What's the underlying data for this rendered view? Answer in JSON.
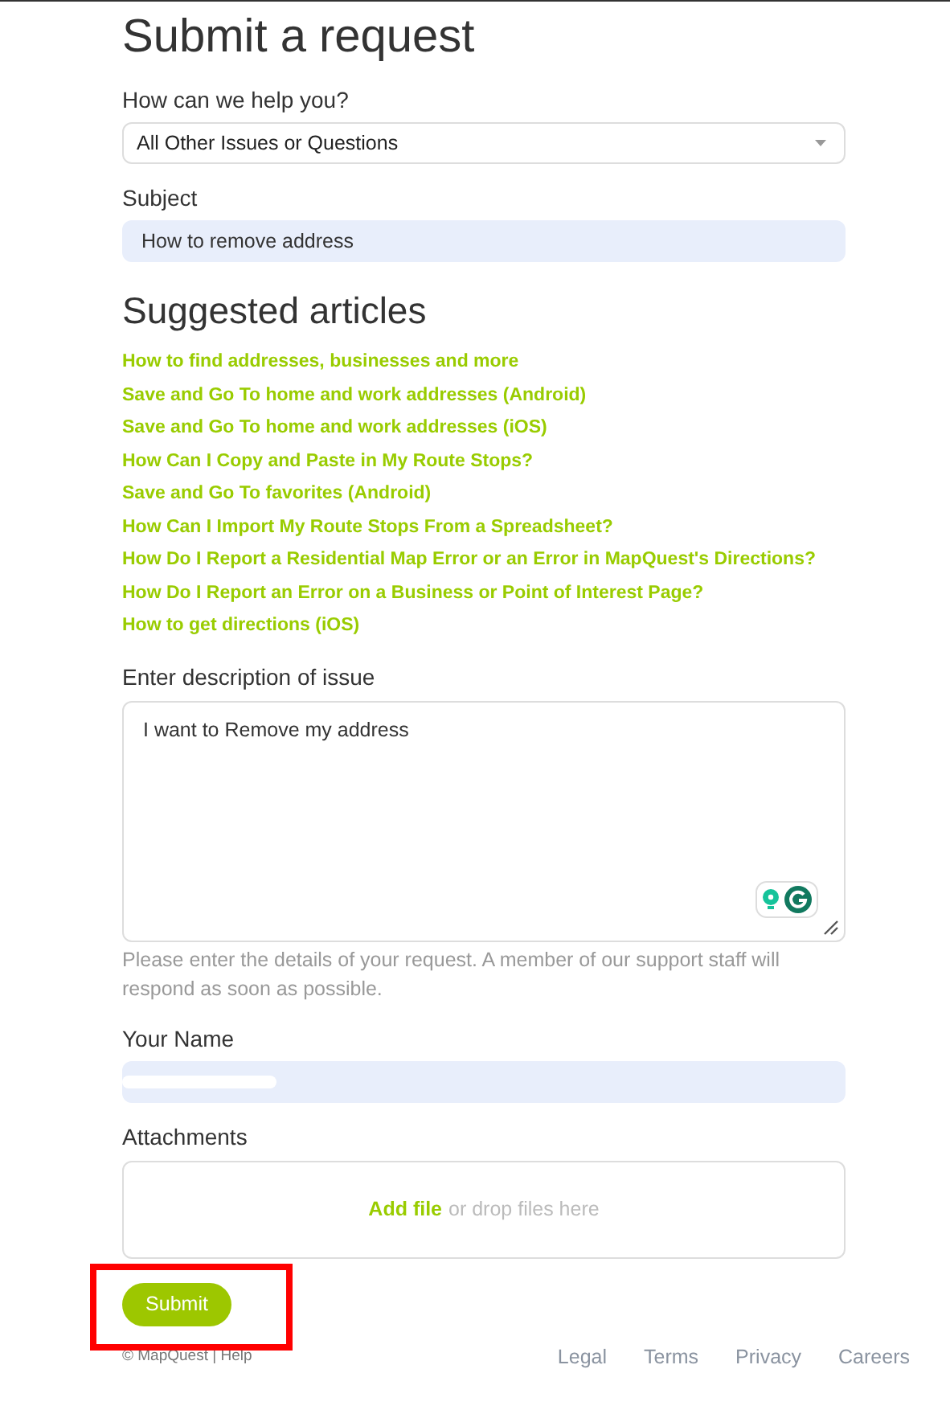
{
  "title": "Submit a request",
  "help_select": {
    "label": "How can we help you?",
    "value": "All Other Issues or Questions"
  },
  "subject": {
    "label": "Subject",
    "value": "How to remove address"
  },
  "suggested": {
    "heading": "Suggested articles",
    "articles": [
      "How to find addresses, businesses and more",
      "Save and Go To home and work addresses (Android)",
      "Save and Go To home and work addresses (iOS)",
      "How Can I Copy and Paste in My Route Stops?",
      "Save and Go To favorites (Android)",
      "How Can I Import My Route Stops From a Spreadsheet?",
      "How Do I Report a Residential Map Error or an Error in MapQuest's Directions?",
      "How Do I Report an Error on a Business or Point of Interest Page?",
      "How to get directions (iOS)"
    ]
  },
  "description": {
    "label": "Enter description of issue",
    "value": "I want to Remove my address",
    "hint": "Please enter the details of your request. A member of our support staff will respond as soon as possible."
  },
  "name": {
    "label": "Your Name"
  },
  "attachments": {
    "label": "Attachments",
    "link": "Add file",
    "text": "or drop files here"
  },
  "submit": "Submit",
  "footer": {
    "copyright": "© MapQuest | Help",
    "links": [
      "Legal",
      "Terms",
      "Privacy",
      "Careers"
    ]
  }
}
